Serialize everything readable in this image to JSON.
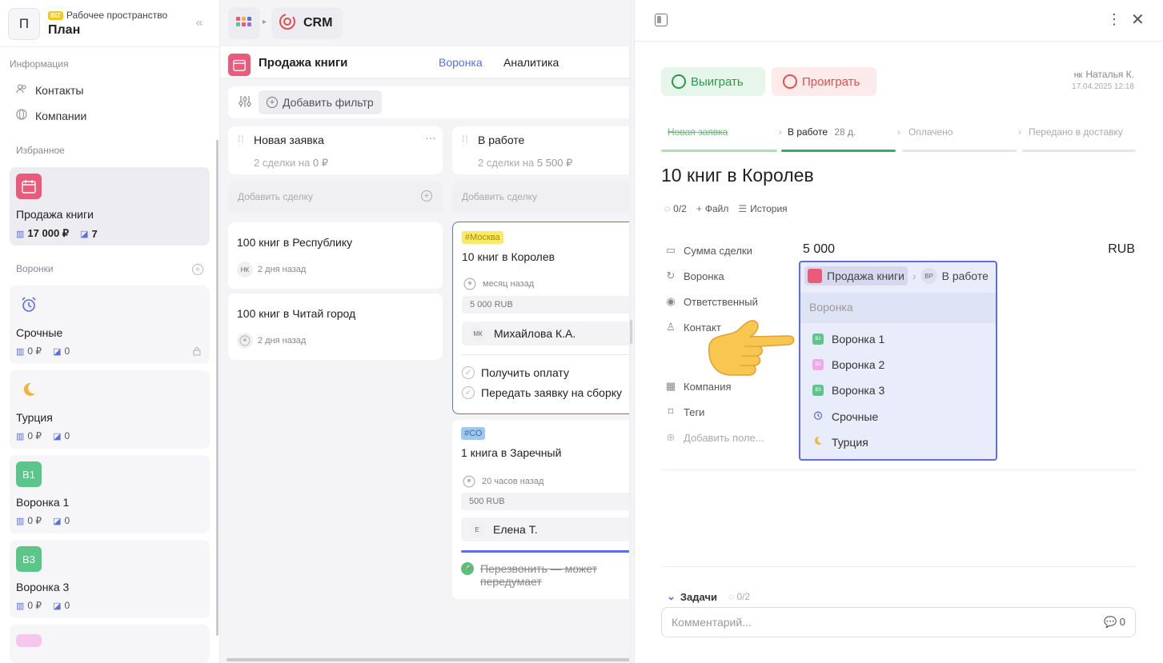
{
  "sidebar": {
    "workspace_letter": "П",
    "workspace_badge": "BIZ",
    "workspace_subtitle": "Рабочее пространство",
    "workspace_title": "План",
    "section_info": "Информация",
    "nav_contacts": "Контакты",
    "nav_companies": "Компании",
    "section_favorites": "Избранное",
    "fav_card": {
      "name": "Продажа книги",
      "sum": "17 000 ₽",
      "count": "7"
    },
    "section_funnels": "Воронки",
    "funnels": [
      {
        "name": "Срочные",
        "sum": "0 ₽",
        "count": "0",
        "icon": "alarm-clock-icon"
      },
      {
        "name": "Турция",
        "sum": "0 ₽",
        "count": "0",
        "icon": "crescent-moon-icon"
      },
      {
        "name": "Воронка 1",
        "sum": "0 ₽",
        "count": "0",
        "badge": "B1",
        "color": "#5bc58a"
      },
      {
        "name": "Воронка 3",
        "sum": "0 ₽",
        "count": "0",
        "badge": "B3",
        "color": "#5bc58a"
      }
    ]
  },
  "topbar": {
    "app": "CRM"
  },
  "board": {
    "title": "Продажа книги",
    "tabs": [
      "Воронка",
      "Аналитика"
    ],
    "active_tab": 0,
    "add_filter": "Добавить фильтр",
    "columns": [
      {
        "title": "Новая заявка",
        "summary_prefix": "2 сделки на",
        "summary_amount": "0 ₽",
        "add_deal": "Добавить сделку",
        "deals": [
          {
            "title": "100 книг в Республику",
            "author": "НК",
            "time": "2 дня назад"
          },
          {
            "title": "100 книг в Читай город",
            "time": "2 дня назад"
          }
        ]
      },
      {
        "title": "В работе",
        "summary_prefix": "2 сделки на",
        "summary_amount": "5 500 ₽",
        "add_deal": "Добавить сделку",
        "deals": [
          {
            "tag": "#Москва",
            "title": "10 книг в Королев",
            "time": "месяц назад",
            "amount": "5 000 RUB",
            "contact_initials": "МК",
            "contact": "Михайлова К.А.",
            "tasks": [
              "Получить оплату",
              "Передать заявку на сборку"
            ]
          },
          {
            "tag": "#СО",
            "title": "1 книга в Заречный",
            "time": "20 часов назад",
            "amount": "500 RUB",
            "contact_initials": "Е",
            "contact": "Елена Т.",
            "tasks": [
              "Перезвонить — может передумает"
            ]
          }
        ]
      }
    ]
  },
  "panel": {
    "win": "Выиграть",
    "lose": "Проиграть",
    "author_initials": "НК",
    "author": "Наталья К.",
    "date": "17.04.2025 12:18",
    "stages": [
      {
        "name": "Новая заявка",
        "state": "done"
      },
      {
        "name": "В работе",
        "days": "28 д.",
        "state": "current"
      },
      {
        "name": "Оплачено",
        "state": "todo"
      },
      {
        "name": "Передано в доставку",
        "state": "todo"
      }
    ],
    "title": "10 книг в Королев",
    "progress": "0/2",
    "file": "Файл",
    "history": "История",
    "fields": {
      "sum": "Сумма сделки",
      "funnel": "Воронка",
      "responsible": "Ответственный",
      "contact": "Контакт",
      "company": "Компания",
      "tags": "Теги",
      "add_field": "Добавить поле..."
    },
    "amount": "5 000",
    "currency": "RUB",
    "dropdown": {
      "crumb_funnel": "Продажа книги",
      "crumb_stage_initials": "ВР",
      "crumb_stage": "В работе",
      "search_placeholder": "Воронка",
      "options": [
        {
          "label": "Воронка 1",
          "badge": "B1",
          "color": "#5bc58a"
        },
        {
          "label": "Воронка 2",
          "badge": "B2",
          "color": "#f0a8e8"
        },
        {
          "label": "Воронка 3",
          "badge": "B3",
          "color": "#5bc58a"
        },
        {
          "label": "Срочные",
          "icon": "alarm-clock-icon"
        },
        {
          "label": "Турция",
          "icon": "crescent-moon-icon"
        }
      ]
    },
    "tasks_label": "Задачи",
    "tasks_progress": "0/2",
    "comment_placeholder": "Комментарий...",
    "comment_count": "0"
  },
  "colors": {
    "accent": "#5b6fe0",
    "win": "#2a9a4a",
    "lose": "#e05050",
    "brand_pink": "#e95a7b"
  }
}
